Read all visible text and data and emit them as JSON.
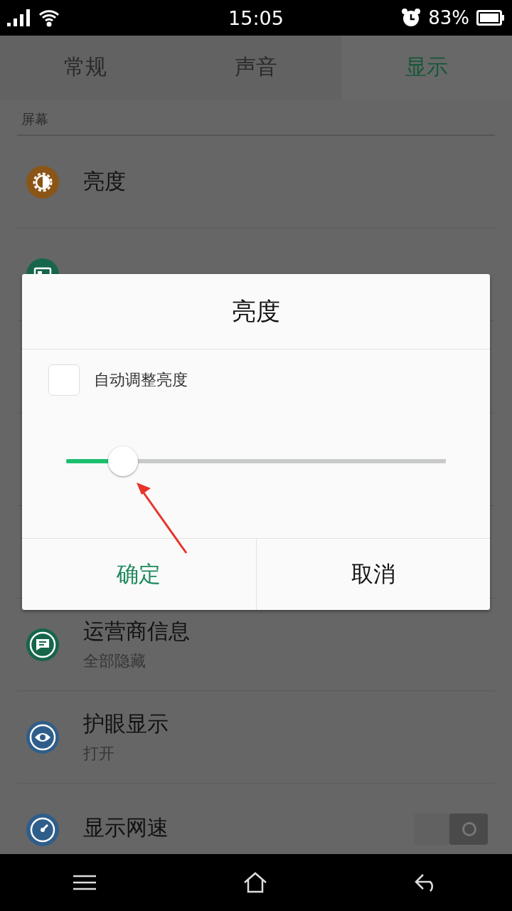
{
  "status_bar": {
    "time": "15:05",
    "battery": "83%"
  },
  "tabs": [
    {
      "label": "常规",
      "selected": false
    },
    {
      "label": "声音",
      "selected": false
    },
    {
      "label": "显示",
      "selected": true
    }
  ],
  "section": "屏幕",
  "settings": [
    {
      "title": "亮度",
      "color": "#8a5516",
      "kind": "link"
    },
    {
      "color": "#16664a",
      "kind": "link"
    },
    {
      "title": "运营商信息",
      "subtitle": "全部隐藏",
      "color": "#16664a",
      "kind": "link"
    },
    {
      "title": "护眼显示",
      "subtitle": "打开",
      "color": "#2f5e8a",
      "kind": "link"
    },
    {
      "title": "显示网速",
      "color": "#2f5e8a",
      "kind": "toggle",
      "on": false
    }
  ],
  "dialog": {
    "title": "亮度",
    "auto_brightness": {
      "label": "自动调整亮度",
      "checked": false
    },
    "slider": {
      "level": 0.15
    },
    "buttons": [
      {
        "label": "确定",
        "kind": "primary"
      },
      {
        "label": "取消",
        "kind": "default"
      }
    ]
  }
}
